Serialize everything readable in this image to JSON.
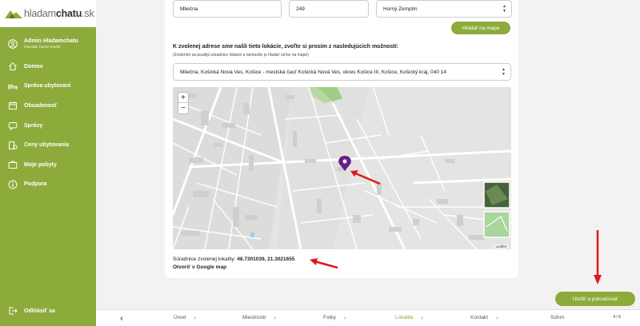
{
  "logo": {
    "part1": "hladam",
    "part2": "chatu",
    "part3": ".sk"
  },
  "user": {
    "name": "Admin Hladamchatu",
    "sub": "(Nemáte žiadne kredit)"
  },
  "sidebar": {
    "items": [
      {
        "label": "Domov",
        "icon": "home-icon"
      },
      {
        "label": "Správa ubytovaní",
        "icon": "bed-icon"
      },
      {
        "label": "Obsadenosť",
        "icon": "calendar-icon"
      },
      {
        "label": "Správy",
        "icon": "message-icon"
      },
      {
        "label": "Ceny ubytovania",
        "icon": "price-icon"
      },
      {
        "label": "Moje pobyty",
        "icon": "suitcase-icon"
      },
      {
        "label": "Podpora",
        "icon": "info-icon"
      }
    ],
    "logout": "Odhlásiť sa"
  },
  "form": {
    "street": "Mliečna",
    "number": "249",
    "region": "Horný Zemplín",
    "search_map": "Hľadať na mape",
    "heading": "K zvolenej adrese sme našli tieto lokácie, zvoľte si prosím z nasledujúcich možností:",
    "hint": "(Zvolením sa použijú súradnice lokácie a nemusíte ju hľadať ručne na mape)",
    "location": "Mliečna, Košická Nová Ves, Košice - mestská časť Košická Nová Ves, okres Košice III, Košice, Košický kraj, 040 14"
  },
  "map": {
    "zoom_in": "+",
    "zoom_out": "−",
    "attribution": "Leaflet"
  },
  "coords": {
    "label": "Súradnice zvolenej lokality:",
    "value": "48.7301039, 21.3021655",
    "google": "Otvoriť v Google map"
  },
  "nav": {
    "back": "‹",
    "steps": [
      "Úvod",
      "Miestnosti",
      "Fotky",
      "Lokalita",
      "Kontakt",
      "Súhrn"
    ],
    "active": "Lokalita",
    "pager": "4 / 6"
  },
  "save": "Uložiť a pokračovať",
  "colors": {
    "accent": "#8dab3a",
    "arrow": "#e0191c",
    "marker": "#6a1b8a"
  }
}
